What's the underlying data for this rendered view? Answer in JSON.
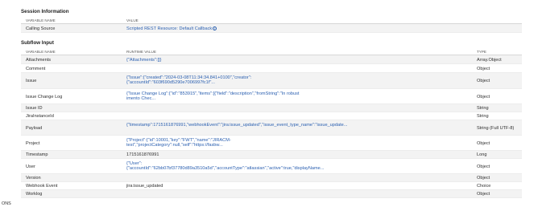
{
  "session": {
    "title": "Session Information",
    "col_name": "VARIABLE NAME",
    "col_value": "VALUE",
    "calling_source_label": "Calling Source",
    "calling_source_value": "Scripted REST Resource: Default Callback"
  },
  "subflow": {
    "title": "Subflow Input",
    "col_name": "VARIABLE NAME",
    "col_value": "RUNTIME VALUE",
    "col_type": "TYPE",
    "rows": [
      {
        "name": "Attachments",
        "value": "{\"Attachments\":[]}",
        "type": "Array.Object"
      },
      {
        "name": "Comment",
        "value": "",
        "type": "Object"
      },
      {
        "name": "Issue",
        "value": "{\"Issue\":{\"created\":\"2024-03-08T11:34:34.841+0100\",\"creator\":{\"accountId\":\"603f690d5290e7006997fc1f\"...",
        "type": "Object"
      },
      {
        "name": "Issue Change Log",
        "value": "{\"Issue Change Log\":{\"id\":\"853915\",\"items\":[{\"field\":\"description\",\"fromString\":\"In robust imento Chec...",
        "type": "Object"
      },
      {
        "name": "Issue ID",
        "value": "",
        "type": "String"
      },
      {
        "name": "JiraInstanceId",
        "value": "",
        "type": "String"
      },
      {
        "name": "Payload",
        "value": "{\"timestamp\":1715161876991,\"webhookEvent\":\"jira:issue_updated\",\"issue_event_type_name\":\"issue_update...",
        "type": "String (Full UTF-8)"
      },
      {
        "name": "Project",
        "value": "{\"Project\":{\"id\":10001,\"key\":\"FWT\",\"name\":\"JIRACM-test\",\"projectCategory\":null,\"self\":\"https://fasbw...",
        "type": "Object"
      },
      {
        "name": "Timestamp",
        "value": "1715161876991",
        "type": "Long"
      },
      {
        "name": "User",
        "value": "{\"User\":{\"accountId\":\"62bb07bf37780d89a3510a5d\",\"accountType\":\"atlassian\",\"active\":true,\"displayName...",
        "type": "Object"
      },
      {
        "name": "Version",
        "value": "",
        "type": "Object"
      },
      {
        "name": "Webhook Event",
        "value": "jira:issue_updated",
        "type": "Choice"
      },
      {
        "name": "Worklog",
        "value": "",
        "type": "Object"
      }
    ]
  },
  "footer": {
    "text": "ONS"
  },
  "icons": {
    "info": "info-icon"
  },
  "colors": {
    "link": "#2a5fb0",
    "stripe": "#f3f3f3"
  }
}
